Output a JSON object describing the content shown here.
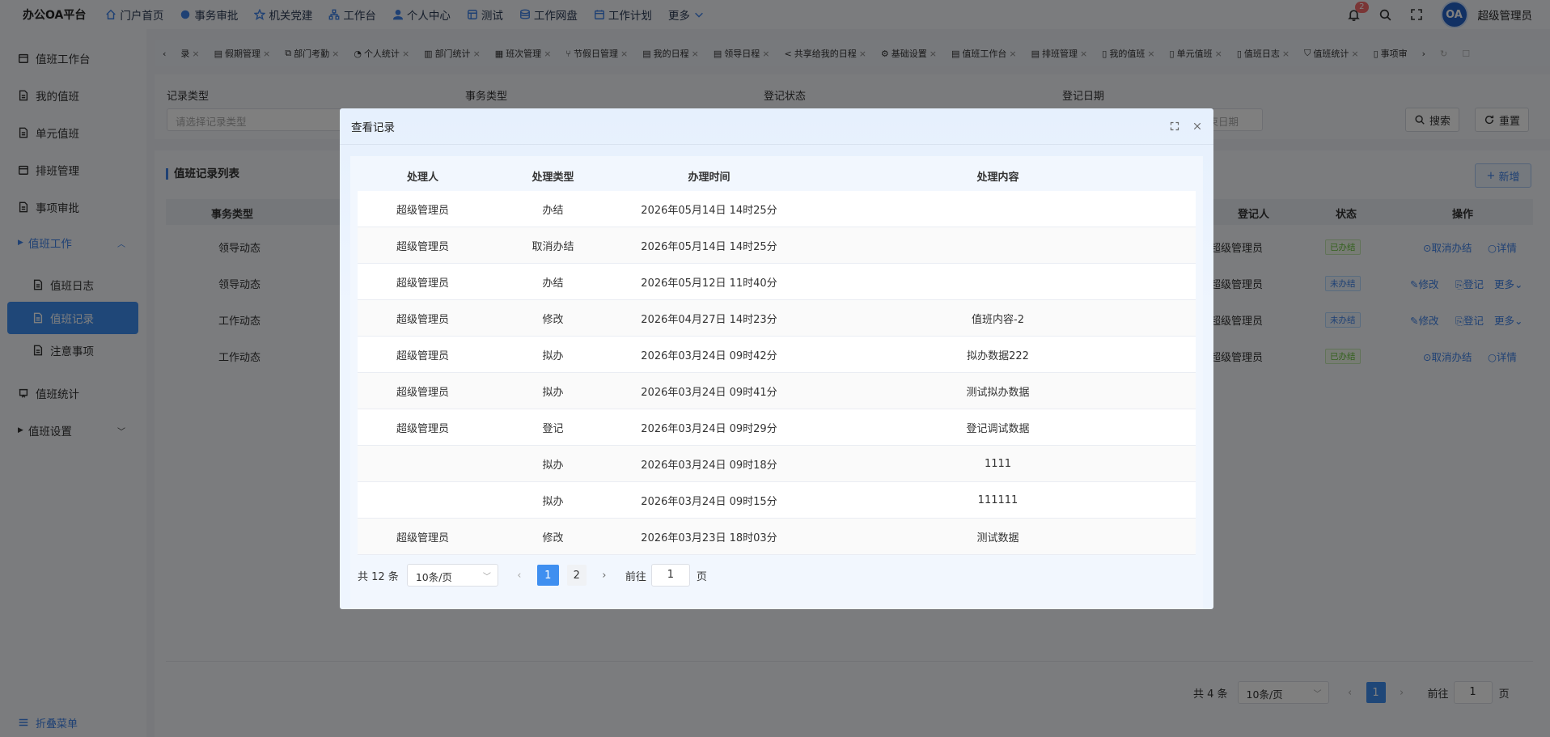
{
  "topbar": {
    "brand": "办公OA平台",
    "nav": [
      {
        "label": "门户首页",
        "icon": "home-icon"
      },
      {
        "label": "事务审批",
        "icon": "approval-icon"
      },
      {
        "label": "机关党建",
        "icon": "star-icon"
      },
      {
        "label": "工作台",
        "icon": "workbench-icon"
      },
      {
        "label": "个人中心",
        "icon": "user-icon"
      },
      {
        "label": "测试",
        "icon": "test-icon"
      },
      {
        "label": "工作网盘",
        "icon": "database-icon"
      },
      {
        "label": "工作计划",
        "icon": "calendar-icon"
      },
      {
        "label": "更多",
        "icon": "chevron-down-icon"
      }
    ],
    "notification_count": "2",
    "avatar_text": "OA",
    "username": "超级管理员"
  },
  "sidebar": {
    "items": [
      {
        "label": "值班工作台"
      },
      {
        "label": "我的值班"
      },
      {
        "label": "单元值班"
      },
      {
        "label": "排班管理"
      },
      {
        "label": "事项审批"
      },
      {
        "label": "值班工作"
      },
      {
        "label": "值班日志"
      },
      {
        "label": "值班记录"
      },
      {
        "label": "注意事项"
      },
      {
        "label": "值班统计"
      },
      {
        "label": "值班设置"
      }
    ],
    "collapse_label": "折叠菜单"
  },
  "tags": [
    "录",
    "假期管理",
    "部门考勤",
    "个人统计",
    "部门统计",
    "班次管理",
    "节假日管理",
    "我的日程",
    "领导日程",
    "共享给我的日程",
    "基础设置",
    "值班工作台",
    "排班管理",
    "我的值班",
    "单元值班",
    "值班日志",
    "值班统计",
    "事项审"
  ],
  "search": {
    "labels": {
      "record_type": "记录类型",
      "affair_type": "事务类型",
      "reg_status": "登记状态",
      "reg_date": "登记日期"
    },
    "record_type_placeholder": "请选择记录类型",
    "end_date_placeholder": "结束日期",
    "search_btn": "搜索",
    "reset_btn": "重置"
  },
  "list": {
    "title": "值班记录列表",
    "add_btn": "新增",
    "headers": {
      "affair_type": "事务类型",
      "registrant": "登记人",
      "status": "状态",
      "ops": "操作"
    },
    "rows": [
      {
        "affair": "领导动态",
        "registrant": "超级管理员",
        "status": "已办结",
        "status_kind": "done",
        "ops": [
          "取消办结",
          "详情"
        ]
      },
      {
        "affair": "领导动态",
        "registrant": "超级管理员",
        "status": "未办结",
        "status_kind": "todo",
        "ops": [
          "修改",
          "登记",
          "更多"
        ]
      },
      {
        "affair": "工作动态",
        "registrant": "超级管理员",
        "status": "未办结",
        "status_kind": "todo",
        "ops": [
          "修改",
          "登记",
          "更多"
        ]
      },
      {
        "affair": "工作动态",
        "registrant": "超级管理员",
        "status": "已办结",
        "status_kind": "done",
        "ops": [
          "取消办结",
          "详情"
        ]
      }
    ],
    "pager": {
      "total": "共 4 条",
      "page_size": "10条/页",
      "current": "1",
      "goto_label": "前往",
      "goto_value": "1",
      "page_unit": "页"
    }
  },
  "modal": {
    "title": "查看记录",
    "headers": {
      "handler": "处理人",
      "type": "处理类型",
      "time": "办理时间",
      "content": "处理内容"
    },
    "rows": [
      {
        "handler": "超级管理员",
        "type": "办结",
        "time": "2026年05月14日 14时25分",
        "content": ""
      },
      {
        "handler": "超级管理员",
        "type": "取消办结",
        "time": "2026年05月14日 14时25分",
        "content": ""
      },
      {
        "handler": "超级管理员",
        "type": "办结",
        "time": "2026年05月12日 11时40分",
        "content": ""
      },
      {
        "handler": "超级管理员",
        "type": "修改",
        "time": "2026年04月27日 14时23分",
        "content": "值班内容-2"
      },
      {
        "handler": "超级管理员",
        "type": "拟办",
        "time": "2026年03月24日 09时42分",
        "content": "拟办数据222"
      },
      {
        "handler": "超级管理员",
        "type": "拟办",
        "time": "2026年03月24日 09时41分",
        "content": "测试拟办数据"
      },
      {
        "handler": "超级管理员",
        "type": "登记",
        "time": "2026年03月24日 09时29分",
        "content": "登记调试数据"
      },
      {
        "handler": "",
        "type": "拟办",
        "time": "2026年03月24日 09时18分",
        "content": "1111"
      },
      {
        "handler": "",
        "type": "拟办",
        "time": "2026年03月24日 09时15分",
        "content": "111111"
      },
      {
        "handler": "超级管理员",
        "type": "修改",
        "time": "2026年03月23日 18时03分",
        "content": "测试数据"
      }
    ],
    "pager": {
      "total": "共 12 条",
      "page_size": "10条/页",
      "pages": [
        "1",
        "2"
      ],
      "current": "1",
      "goto_label": "前往",
      "goto_value": "1",
      "page_unit": "页"
    }
  },
  "colors": {
    "accent": "#3f8ff0",
    "done": "#67c23a",
    "overlay": "rgba(0,0,0,0.5)"
  }
}
